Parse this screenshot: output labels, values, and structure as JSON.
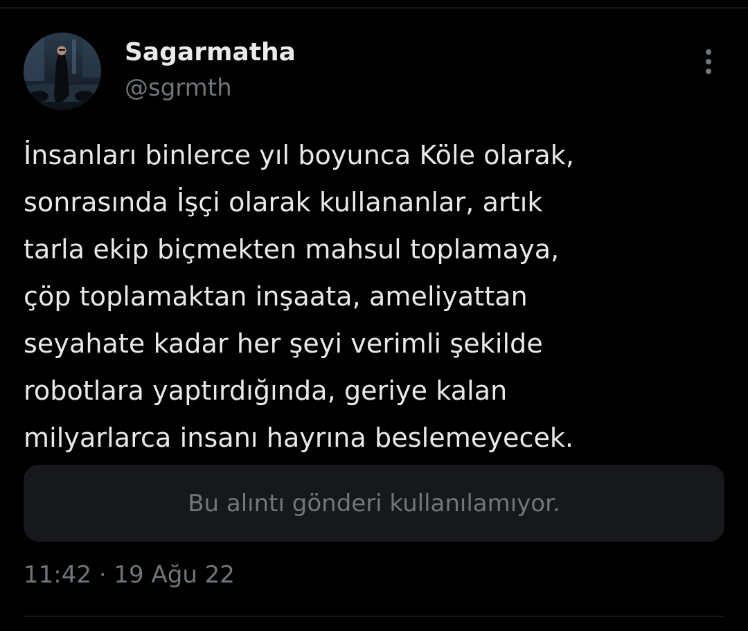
{
  "tweet": {
    "author": {
      "display_name": "Sagarmatha",
      "handle": "@sgrmth"
    },
    "text": "İnsanları binlerce yıl boyunca Köle olarak,\nsonrasında İşçi olarak kullananlar, artık\ntarla ekip biçmekten mahsul toplamaya,\nçöp toplamaktan inşaata, ameliyattan\nseyahate kadar her şeyi verimli şekilde\nrobotlara yaptırdığında, geriye kalan\nmilyarlarca insanı hayrına beslemeyecek.",
    "quote_unavailable": "Bu alıntı gönderi kullanılamıyor.",
    "timestamp": "11:42 · 19 Ağu 22"
  },
  "icons": {
    "more": "more-vertical-icon"
  },
  "colors": {
    "background": "#000000",
    "primary_text": "#e7e9ea",
    "secondary_text": "#71767b",
    "quote_background": "#16181c",
    "divider": "#2f3336"
  }
}
